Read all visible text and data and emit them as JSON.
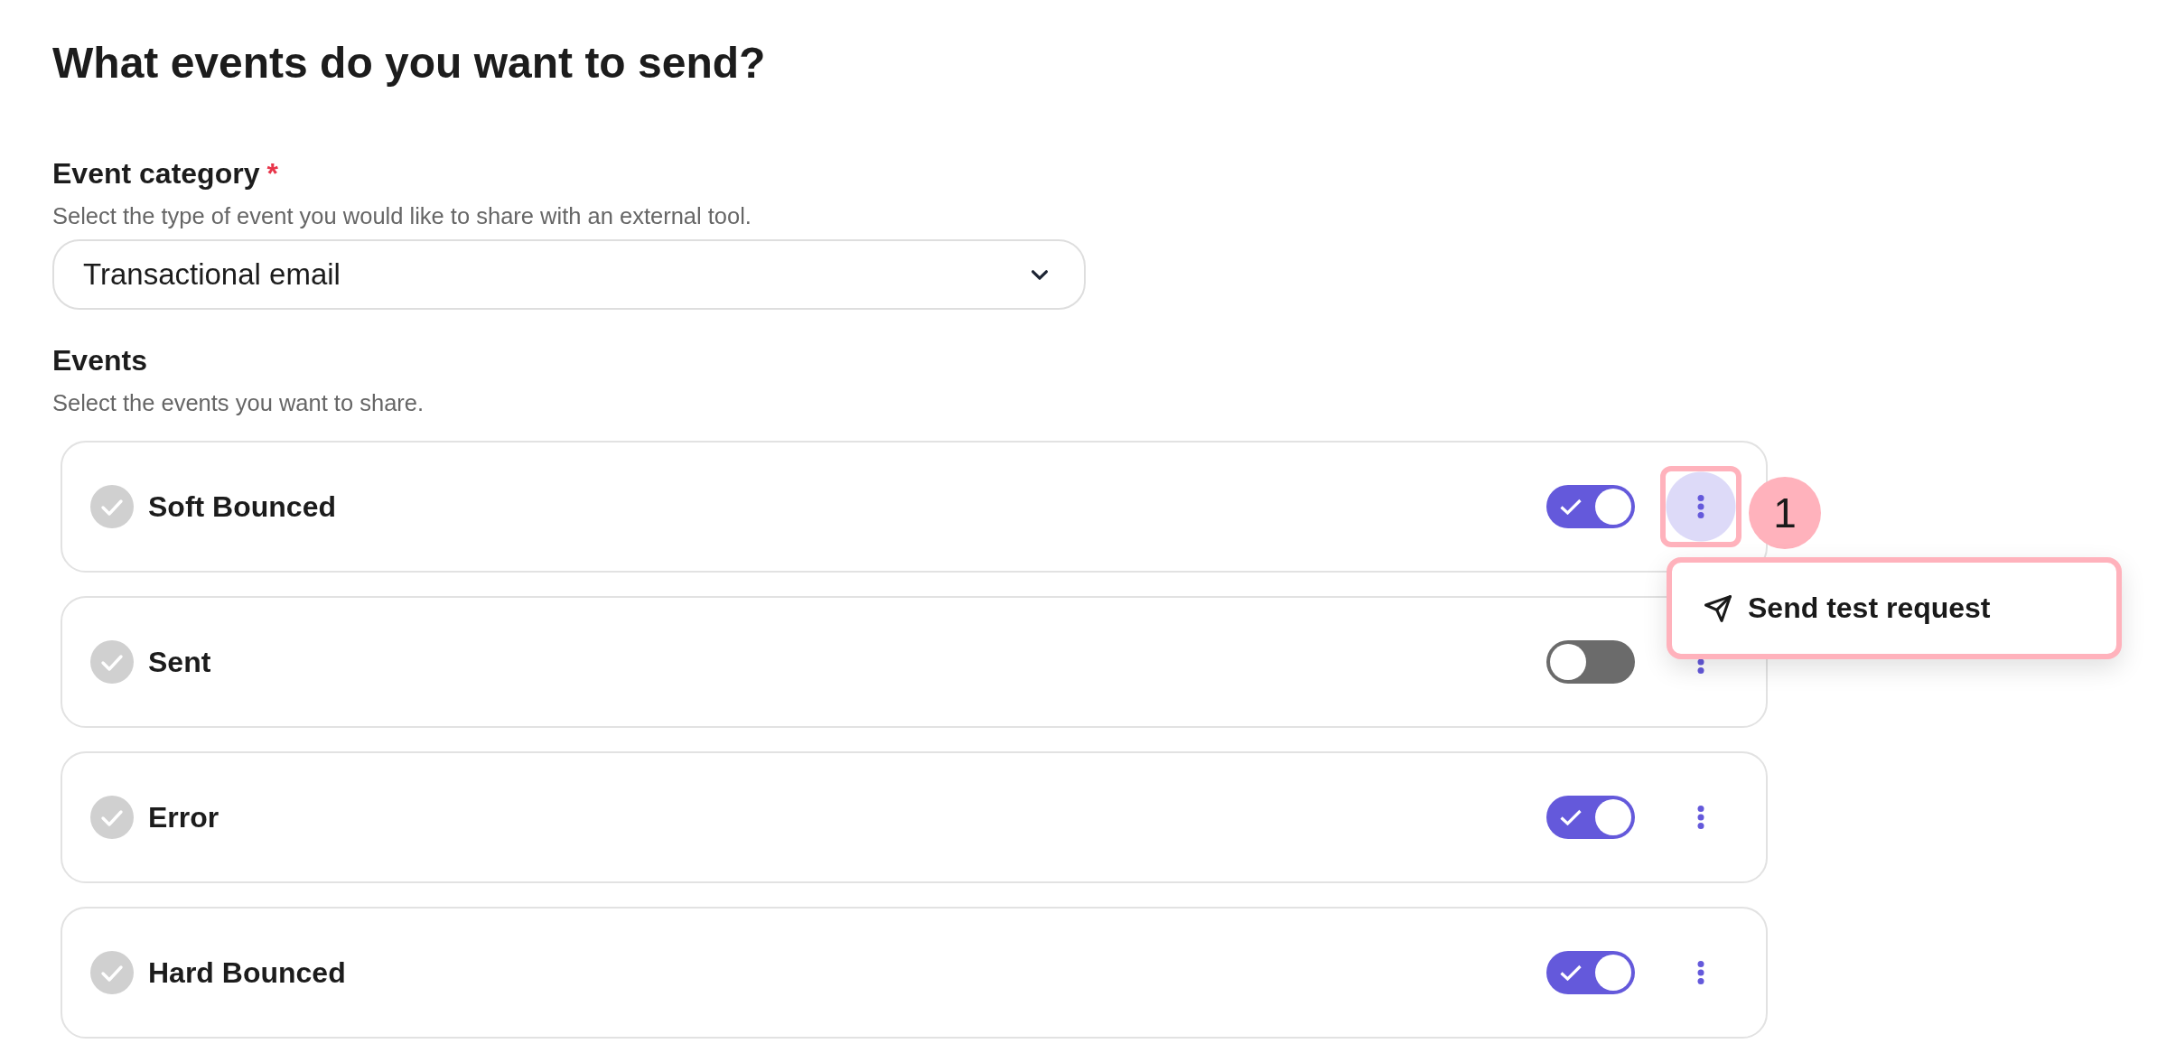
{
  "title": "What events do you want to send?",
  "category": {
    "label": "Event category",
    "required_mark": "*",
    "help": "Select the type of event you would like to share with an external tool.",
    "value": "Transactional email"
  },
  "events": {
    "label": "Events",
    "help": "Select the events you want to share.",
    "items": [
      {
        "name": "Soft Bounced",
        "on": true,
        "menu_open": true
      },
      {
        "name": "Sent",
        "on": false,
        "menu_open": false
      },
      {
        "name": "Error",
        "on": true,
        "menu_open": false
      },
      {
        "name": "Hard Bounced",
        "on": true,
        "menu_open": false
      }
    ]
  },
  "menu": {
    "items": [
      {
        "label": "Send test request"
      }
    ]
  },
  "annotation": {
    "label": "1"
  }
}
